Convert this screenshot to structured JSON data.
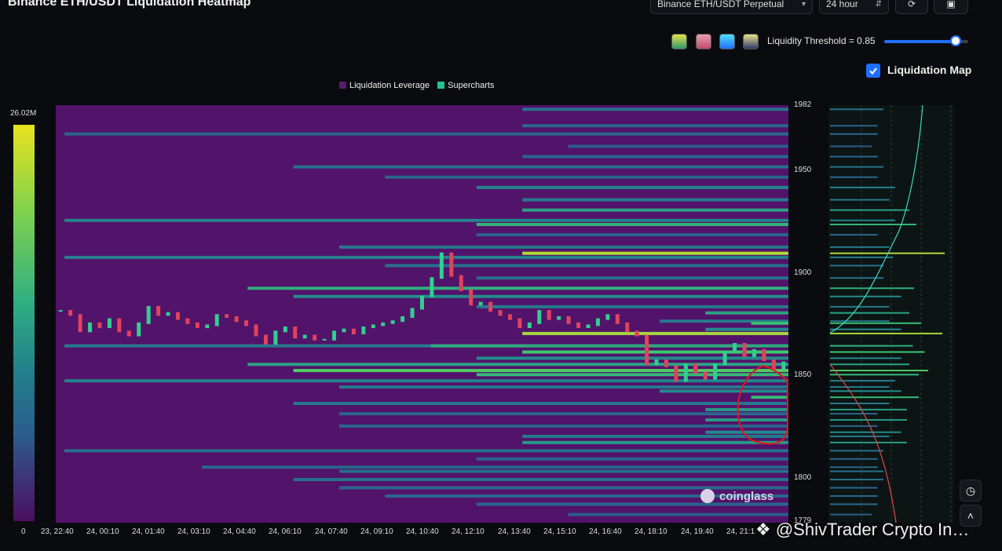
{
  "header": {
    "title": "Binance ETH/USDT Liquidation Heatmap",
    "pair_select": "Binance ETH/USDT Perpetual",
    "range_select": "24 hour"
  },
  "controls": {
    "threshold_label": "Liquidity Threshold = 0.85",
    "threshold_value": 0.85,
    "liquidation_map_label": "Liquidation Map",
    "liquidation_map_checked": true,
    "swatch_colors": [
      [
        "#2d9a6e",
        "#e6e04a"
      ],
      [
        "#c14a6a",
        "#e8a0b0"
      ],
      [
        "#1f6fff",
        "#50e0ff"
      ],
      [
        "#2c3a6b",
        "#e8e28a"
      ]
    ]
  },
  "watermark": "coinglass",
  "credit": "❖ @ShivTrader Crypto In…",
  "chart_data": {
    "type": "heatmap",
    "title": "",
    "legend": [
      {
        "name": "Liquidation Leverage",
        "color": "#5b1a6e"
      },
      {
        "name": "Supercharts",
        "color": "#22c38e"
      }
    ],
    "colorbar": {
      "max_label": "26.02M",
      "min_label": "0"
    },
    "ylim": [
      1779,
      1982
    ],
    "y_ticks": [
      "1982",
      "1950",
      "1900",
      "1850",
      "1800",
      "1779"
    ],
    "x_ticks": [
      "23, 22:40",
      "24, 00:10",
      "24, 01:40",
      "24, 03:10",
      "24, 04:40",
      "24, 06:10",
      "24, 07:40",
      "24, 09:10",
      "24, 10:40",
      "24, 12:10",
      "24, 13:40",
      "24, 15:10",
      "24, 16:40",
      "24, 18:10",
      "24, 19:40",
      "24, 21:1"
    ],
    "heat_bands": [
      {
        "price": 1980,
        "start": "24, 13:40",
        "intensity": 0.4
      },
      {
        "price": 1972,
        "start": "24, 13:40",
        "intensity": 0.35
      },
      {
        "price": 1968,
        "start": "23, 22:40",
        "intensity": 0.35
      },
      {
        "price": 1962,
        "start": "24, 15:10",
        "intensity": 0.3
      },
      {
        "price": 1957,
        "start": "24, 13:40",
        "intensity": 0.35
      },
      {
        "price": 1952,
        "start": "24, 06:10",
        "intensity": 0.4
      },
      {
        "price": 1947,
        "start": "24, 09:10",
        "intensity": 0.35
      },
      {
        "price": 1942,
        "start": "24, 12:10",
        "intensity": 0.5
      },
      {
        "price": 1936,
        "start": "24, 13:40",
        "intensity": 0.45
      },
      {
        "price": 1931,
        "start": "24, 13:40",
        "intensity": 0.62
      },
      {
        "price": 1926,
        "start": "23, 22:40",
        "intensity": 0.5
      },
      {
        "price": 1924,
        "start": "24, 12:10",
        "intensity": 0.68
      },
      {
        "price": 1919,
        "start": "24, 12:10",
        "intensity": 0.35
      },
      {
        "price": 1913,
        "start": "24, 07:40",
        "intensity": 0.45
      },
      {
        "price": 1910,
        "start": "24, 13:40",
        "intensity": 0.92
      },
      {
        "price": 1908,
        "start": "23, 22:40",
        "intensity": 0.48
      },
      {
        "price": 1904,
        "start": "24, 09:10",
        "intensity": 0.4
      },
      {
        "price": 1898,
        "start": "24, 12:10",
        "intensity": 0.4
      },
      {
        "price": 1893,
        "start": "24, 04:40",
        "intensity": 0.66
      },
      {
        "price": 1889,
        "start": "24, 06:10",
        "intensity": 0.55
      },
      {
        "price": 1884,
        "start": "24, 12:10",
        "intensity": 0.45
      },
      {
        "price": 1881,
        "start": "24, 19:40",
        "intensity": 0.62
      },
      {
        "price": 1877,
        "start": "24, 18:10",
        "intensity": 0.45
      },
      {
        "price": 1876,
        "start": "24, 21:1",
        "intensity": 0.72
      },
      {
        "price": 1873,
        "start": "24, 19:40",
        "intensity": 0.55
      },
      {
        "price": 1871,
        "start": "24, 13:40",
        "intensity": 0.9
      },
      {
        "price": 1865,
        "start": "23, 22:40",
        "intensity": 0.45
      },
      {
        "price": 1865,
        "start": "24, 10:40",
        "intensity": 0.65
      },
      {
        "price": 1862,
        "start": "24, 13:40",
        "intensity": 0.75
      },
      {
        "price": 1859,
        "start": "24, 12:10",
        "intensity": 0.55
      },
      {
        "price": 1856,
        "start": "24, 04:40",
        "intensity": 0.62
      },
      {
        "price": 1853,
        "start": "24, 06:10",
        "intensity": 0.78
      },
      {
        "price": 1851,
        "start": "24, 12:10",
        "intensity": 0.7
      },
      {
        "price": 1848,
        "start": "23, 22:40",
        "intensity": 0.5
      },
      {
        "price": 1845,
        "start": "24, 07:40",
        "intensity": 0.45
      },
      {
        "price": 1843,
        "start": "24, 18:10",
        "intensity": 0.55
      },
      {
        "price": 1840,
        "start": "24, 21:1",
        "intensity": 0.7
      },
      {
        "price": 1837,
        "start": "24, 06:10",
        "intensity": 0.45
      },
      {
        "price": 1834,
        "start": "24, 19:40",
        "intensity": 0.6
      },
      {
        "price": 1832,
        "start": "24, 07:40",
        "intensity": 0.35
      },
      {
        "price": 1829,
        "start": "24, 19:40",
        "intensity": 0.6
      },
      {
        "price": 1826,
        "start": "24, 07:40",
        "intensity": 0.35
      },
      {
        "price": 1823,
        "start": "24, 19:40",
        "intensity": 0.55
      },
      {
        "price": 1821,
        "start": "24, 13:40",
        "intensity": 0.45
      },
      {
        "price": 1818,
        "start": "24, 13:40",
        "intensity": 0.6
      },
      {
        "price": 1814,
        "start": "23, 22:40",
        "intensity": 0.4
      },
      {
        "price": 1810,
        "start": "24, 12:10",
        "intensity": 0.35
      },
      {
        "price": 1806,
        "start": "24, 03:10",
        "intensity": 0.35
      },
      {
        "price": 1804,
        "start": "24, 07:40",
        "intensity": 0.4
      },
      {
        "price": 1800,
        "start": "24, 06:10",
        "intensity": 0.4
      },
      {
        "price": 1796,
        "start": "24, 07:40",
        "intensity": 0.35
      },
      {
        "price": 1792,
        "start": "24, 09:10",
        "intensity": 0.35
      },
      {
        "price": 1788,
        "start": "24, 12:10",
        "intensity": 0.35
      },
      {
        "price": 1783,
        "start": "24, 15:10",
        "intensity": 0.3
      }
    ],
    "price_series": [
      1882,
      1880,
      1872,
      1876,
      1874,
      1878,
      1872,
      1870,
      1876,
      1884,
      1880,
      1881,
      1878,
      1876,
      1874,
      1875,
      1880,
      1879,
      1877,
      1875,
      1870,
      1866,
      1872,
      1874,
      1869,
      1870,
      1868,
      1868,
      1872,
      1873,
      1871,
      1874,
      1875,
      1876,
      1877,
      1879,
      1883,
      1889,
      1898,
      1910,
      1899,
      1892,
      1885,
      1886,
      1882,
      1880,
      1878,
      1874,
      1876,
      1882,
      1878,
      1879,
      1876,
      1874,
      1875,
      1878,
      1880,
      1876,
      1872,
      1870,
      1856,
      1858,
      1855,
      1848,
      1856,
      1852,
      1849,
      1856,
      1862,
      1866,
      1860,
      1863,
      1858,
      1854,
      1857
    ]
  }
}
